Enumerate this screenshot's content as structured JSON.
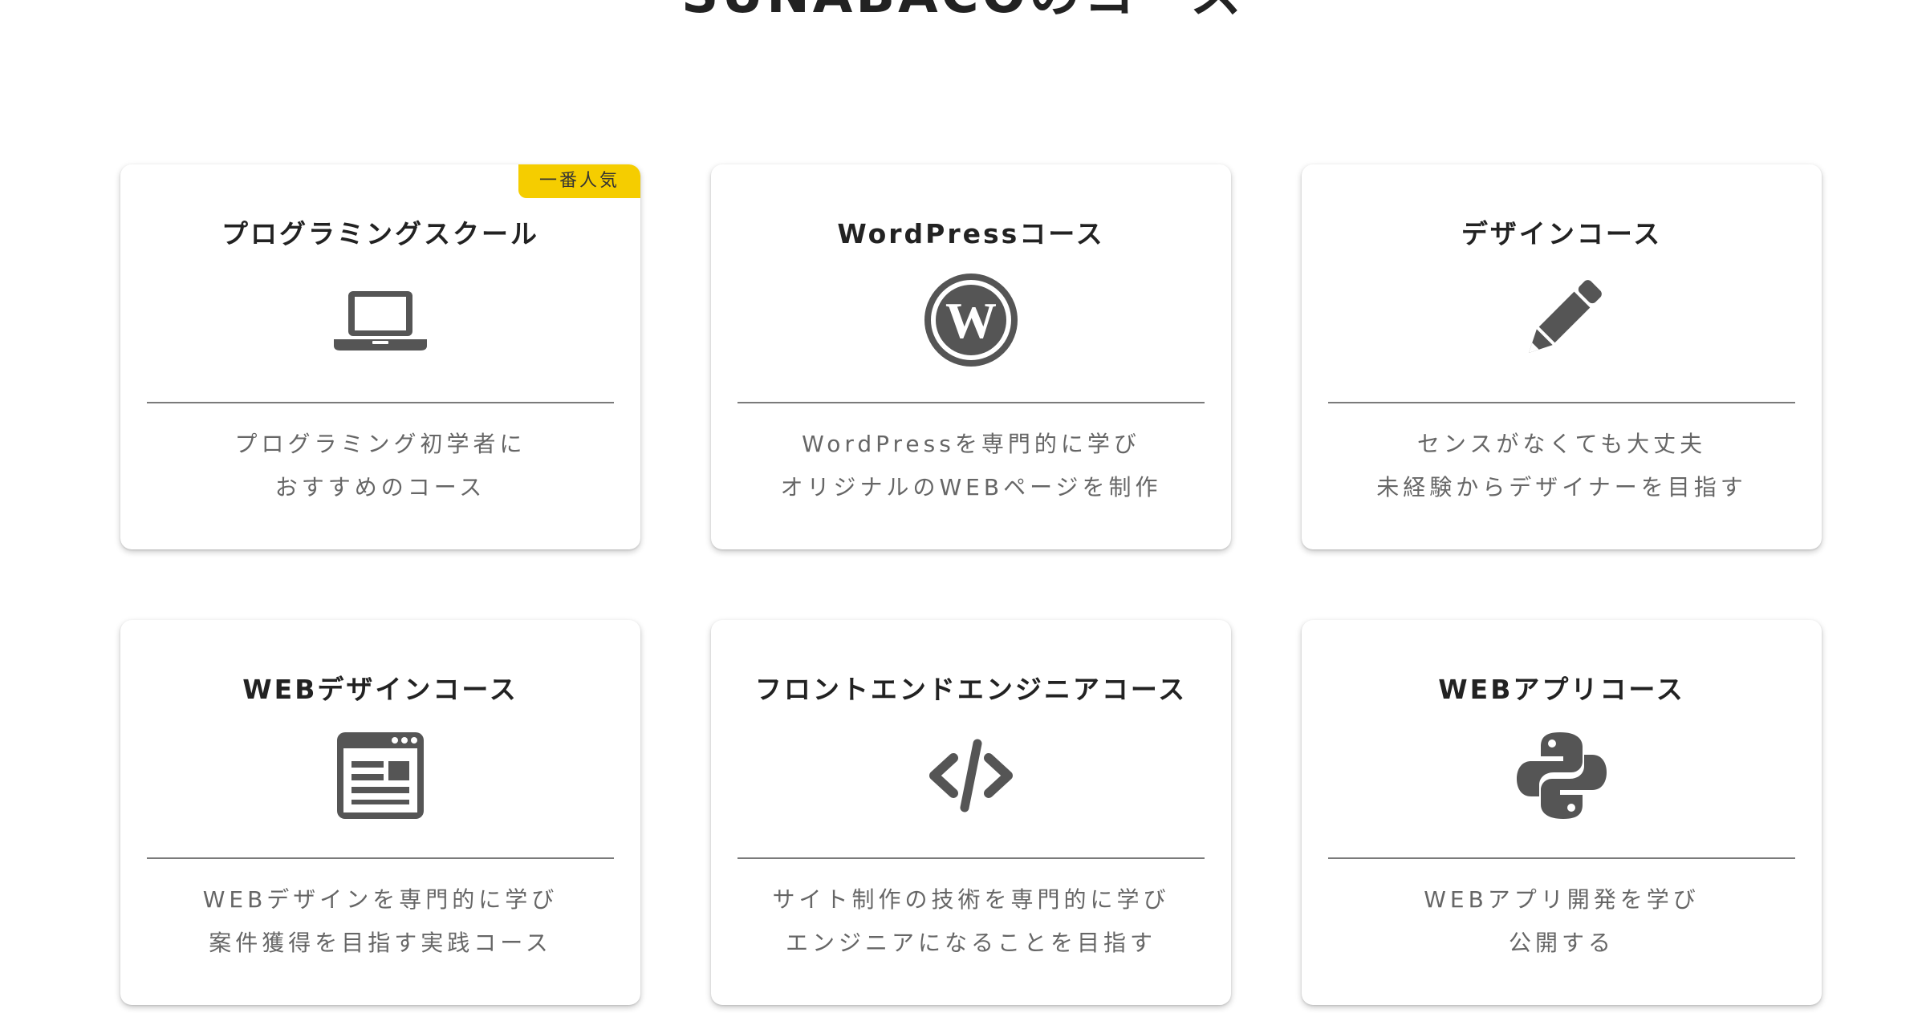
{
  "section": {
    "title": "SUNABACOのコース"
  },
  "colors": {
    "badge": "#f5cd00",
    "icon": "#555555",
    "text": "#333333"
  },
  "courses": [
    {
      "title": "プログラミングスクール",
      "badge": "一番人気",
      "icon": "laptop-icon",
      "desc1": "プログラミング初学者に",
      "desc2": "おすすめのコース"
    },
    {
      "title": "WordPressコース",
      "icon": "wordpress-icon",
      "desc1": "WordPressを専門的に学び",
      "desc2": "オリジナルのWEBページを制作"
    },
    {
      "title": "デザインコース",
      "icon": "pencil-icon",
      "desc1": "センスがなくても大丈夫",
      "desc2": "未経験からデザイナーを目指す"
    },
    {
      "title": "WEBデザインコース",
      "icon": "webpage-icon",
      "desc1": "WEBデザインを専門的に学び",
      "desc2": "案件獲得を目指す実践コース"
    },
    {
      "title": "フロントエンドエンジニアコース",
      "icon": "code-icon",
      "desc1": "サイト制作の技術を専門的に学び",
      "desc2": "エンジニアになることを目指す"
    },
    {
      "title": "WEBアプリコース",
      "icon": "python-icon",
      "desc1": "WEBアプリ開発を学び",
      "desc2": "公開する"
    }
  ]
}
